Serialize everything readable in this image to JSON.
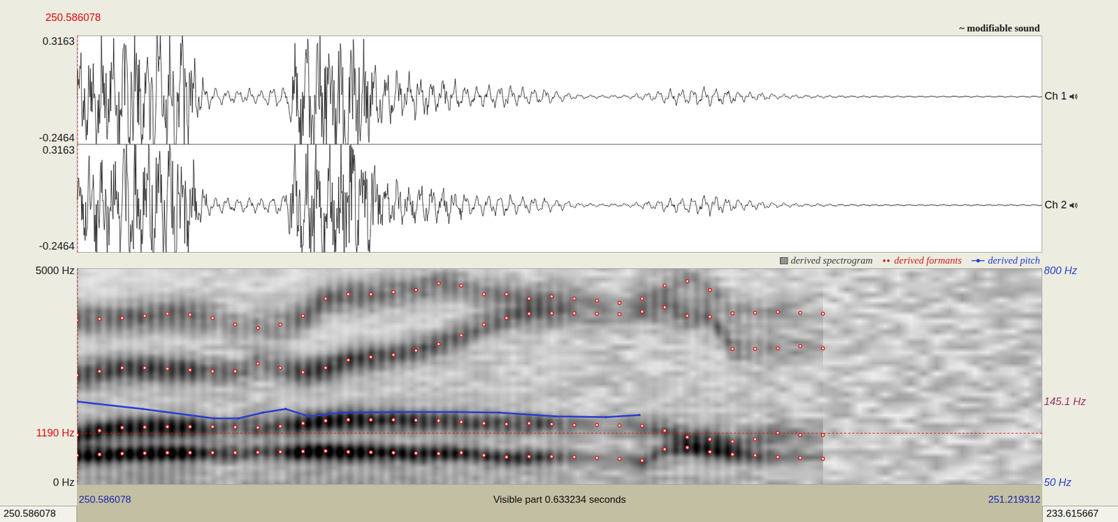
{
  "window": {
    "cursor_time": "250.586078",
    "status": "~ modifiable sound"
  },
  "channels": [
    {
      "name": "Ch 1",
      "max": "0.3163",
      "min": "-0.2464",
      "max_value": 0.3163,
      "min_value": -0.2464,
      "envelope": [
        0.18,
        0.2,
        0.22,
        0.25,
        0.3,
        0.28,
        0.3,
        0.25,
        0.3,
        0.28,
        0.12,
        0.06,
        0.05,
        0.04,
        0.05,
        0.04,
        0.06,
        0.07,
        0.25,
        0.28,
        0.3,
        0.28,
        0.3,
        0.29,
        0.2,
        0.14,
        0.15,
        0.12,
        0.13,
        0.11,
        0.1,
        0.09,
        0.07,
        0.06,
        0.07,
        0.07,
        0.06,
        0.05,
        0.05,
        0.04,
        0.03,
        0.015,
        0.012,
        0.01,
        0.01,
        0.012,
        0.02,
        0.03,
        0.04,
        0.05,
        0.05,
        0.06,
        0.06,
        0.05,
        0.04,
        0.03,
        0.025,
        0.02,
        0.015,
        0.012,
        0.01,
        0.01,
        0.008,
        0.006,
        0.006,
        0.005,
        0.005,
        0.005,
        0.004,
        0.004,
        0.004,
        0.004,
        0.004,
        0.004,
        0.004,
        0.004,
        0.004,
        0.004,
        0.004,
        0.004
      ]
    },
    {
      "name": "Ch 2",
      "max": "0.3163",
      "min": "-0.2464",
      "max_value": 0.3163,
      "min_value": -0.2464,
      "envelope": [
        0.18,
        0.2,
        0.22,
        0.25,
        0.3,
        0.28,
        0.3,
        0.25,
        0.3,
        0.28,
        0.12,
        0.06,
        0.05,
        0.04,
        0.05,
        0.04,
        0.06,
        0.07,
        0.25,
        0.28,
        0.3,
        0.28,
        0.3,
        0.29,
        0.2,
        0.14,
        0.15,
        0.12,
        0.13,
        0.11,
        0.1,
        0.09,
        0.07,
        0.06,
        0.07,
        0.07,
        0.06,
        0.05,
        0.05,
        0.04,
        0.03,
        0.015,
        0.012,
        0.01,
        0.01,
        0.012,
        0.02,
        0.03,
        0.04,
        0.05,
        0.05,
        0.06,
        0.06,
        0.05,
        0.04,
        0.03,
        0.025,
        0.02,
        0.015,
        0.012,
        0.01,
        0.01,
        0.008,
        0.006,
        0.006,
        0.005,
        0.005,
        0.005,
        0.004,
        0.004,
        0.004,
        0.004,
        0.004,
        0.004,
        0.004,
        0.004,
        0.004,
        0.004,
        0.004,
        0.004
      ]
    }
  ],
  "legend": [
    {
      "label": "derived spectrogram",
      "kind": "spectrogram",
      "color": "#444444"
    },
    {
      "label": "derived formants",
      "kind": "formants",
      "color": "#d42020"
    },
    {
      "label": "derived pitch",
      "kind": "pitch",
      "color": "#2a3fcf"
    }
  ],
  "spectrogram": {
    "top_label": "5000 Hz",
    "bottom_label": "0 Hz",
    "max_hz": 5000,
    "cursor_label": "1190 Hz",
    "cursor_hz": 1190
  },
  "pitch": {
    "top_label": "800 Hz",
    "bottom_label": "50 Hz",
    "max_hz": 800,
    "min_hz": 50,
    "cursor_label": "145.1 Hz",
    "cursor_hz": 145.1,
    "points": [
      [
        0,
        145.1
      ],
      [
        0.043,
        132
      ],
      [
        0.09,
        117
      ],
      [
        0.106,
        117
      ],
      [
        0.122,
        126
      ],
      [
        0.137,
        132
      ],
      [
        0.152,
        120
      ],
      [
        0.174,
        126
      ],
      [
        0.211,
        127
      ],
      [
        0.249,
        127
      ],
      [
        0.277,
        126
      ],
      [
        0.314,
        120
      ],
      [
        0.347,
        119
      ],
      [
        0.369,
        122
      ]
    ]
  },
  "formants": {
    "frame_step_s": 0.01483,
    "tracks": [
      [
        680,
        700,
        720,
        730,
        740,
        740,
        740,
        740,
        750,
        760,
        770,
        780,
        760,
        750,
        740,
        730,
        720,
        740,
        680,
        640,
        650,
        650,
        640,
        620,
        600,
        560,
        820,
        860,
        760,
        700,
        680,
        640,
        620,
        600
      ],
      [
        1150,
        1250,
        1320,
        1330,
        1340,
        1340,
        1340,
        1330,
        1320,
        1350,
        1420,
        1480,
        1500,
        1500,
        1500,
        1490,
        1480,
        1450,
        1420,
        1400,
        1420,
        1400,
        1380,
        1380,
        1370,
        1360,
        1250,
        1100,
        1050,
        1000,
        1050,
        1200,
        1150,
        1150
      ],
      [
        2530,
        2620,
        2700,
        2700,
        2680,
        2650,
        2620,
        2620,
        2800,
        2700,
        2600,
        2700,
        2880,
        2950,
        3000,
        3100,
        3250,
        3450,
        3700,
        3850,
        3950,
        3960,
        3960,
        3950,
        3940,
        4000,
        4100,
        3900,
        3880,
        3140,
        3140,
        3150,
        3200,
        3150
      ],
      [
        3800,
        3830,
        3850,
        3900,
        3950,
        3930,
        3850,
        3700,
        3620,
        3700,
        3900,
        4300,
        4400,
        4400,
        4450,
        4500,
        4650,
        4600,
        4400,
        4400,
        4300,
        4350,
        4300,
        4250,
        4200,
        4300,
        4600,
        4700,
        4500,
        3960,
        3970,
        3990,
        3970,
        3950
      ]
    ]
  },
  "time_bar": {
    "start": "250.586078",
    "visible": "Visible part 0.633234 seconds",
    "end": "251.219312",
    "duration_s": 0.633234,
    "left_cell": "250.586078",
    "right_cell": "233.615667"
  }
}
